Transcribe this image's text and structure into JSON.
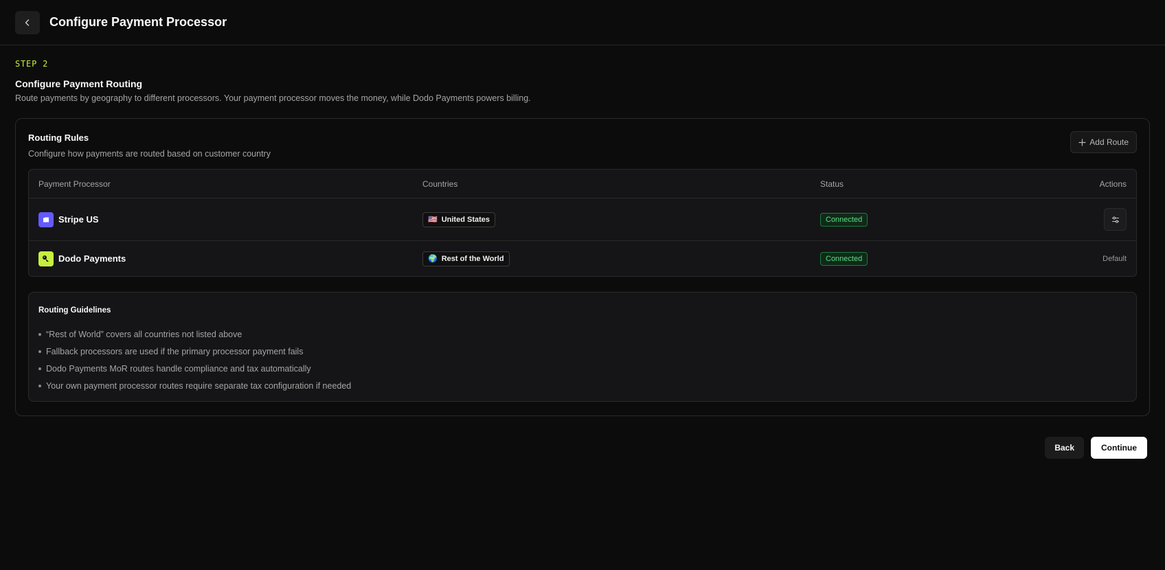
{
  "header": {
    "title": "Configure Payment Processor"
  },
  "step": {
    "label": "STEP 2",
    "title": "Configure Payment Routing",
    "description": "Route payments by geography to different processors. Your payment processor moves the money, while Dodo Payments powers billing."
  },
  "routing": {
    "title": "Routing Rules",
    "description": "Configure how payments are routed based on customer country",
    "add_label": "Add Route",
    "columns": [
      "Payment Processor",
      "Countries",
      "Status",
      "Actions"
    ],
    "rows": [
      {
        "processor": "Stripe US",
        "country_flag": "🇺🇸",
        "country": "United States",
        "status": "Connected",
        "action": "settings-icon"
      },
      {
        "processor": "Dodo Payments",
        "country_flag": "🌍",
        "country": "Rest of the World",
        "status": "Connected",
        "action": "Default"
      }
    ]
  },
  "guidelines": {
    "title": "Routing Guidelines",
    "items": [
      "“Rest of World” covers all countries not listed above",
      "Fallback processors are used if the primary processor payment fails",
      "Dodo Payments MoR routes handle compliance and tax automatically",
      "Your own payment processor routes require separate tax configuration if needed"
    ]
  },
  "footer": {
    "back_label": "Back",
    "continue_label": "Continue"
  },
  "colors": {
    "accent": "#c6f03f",
    "stripe": "#635bff",
    "dodo": "#c6f03f",
    "status_green": "#5fdd8a",
    "background": "#0c0c0c"
  }
}
